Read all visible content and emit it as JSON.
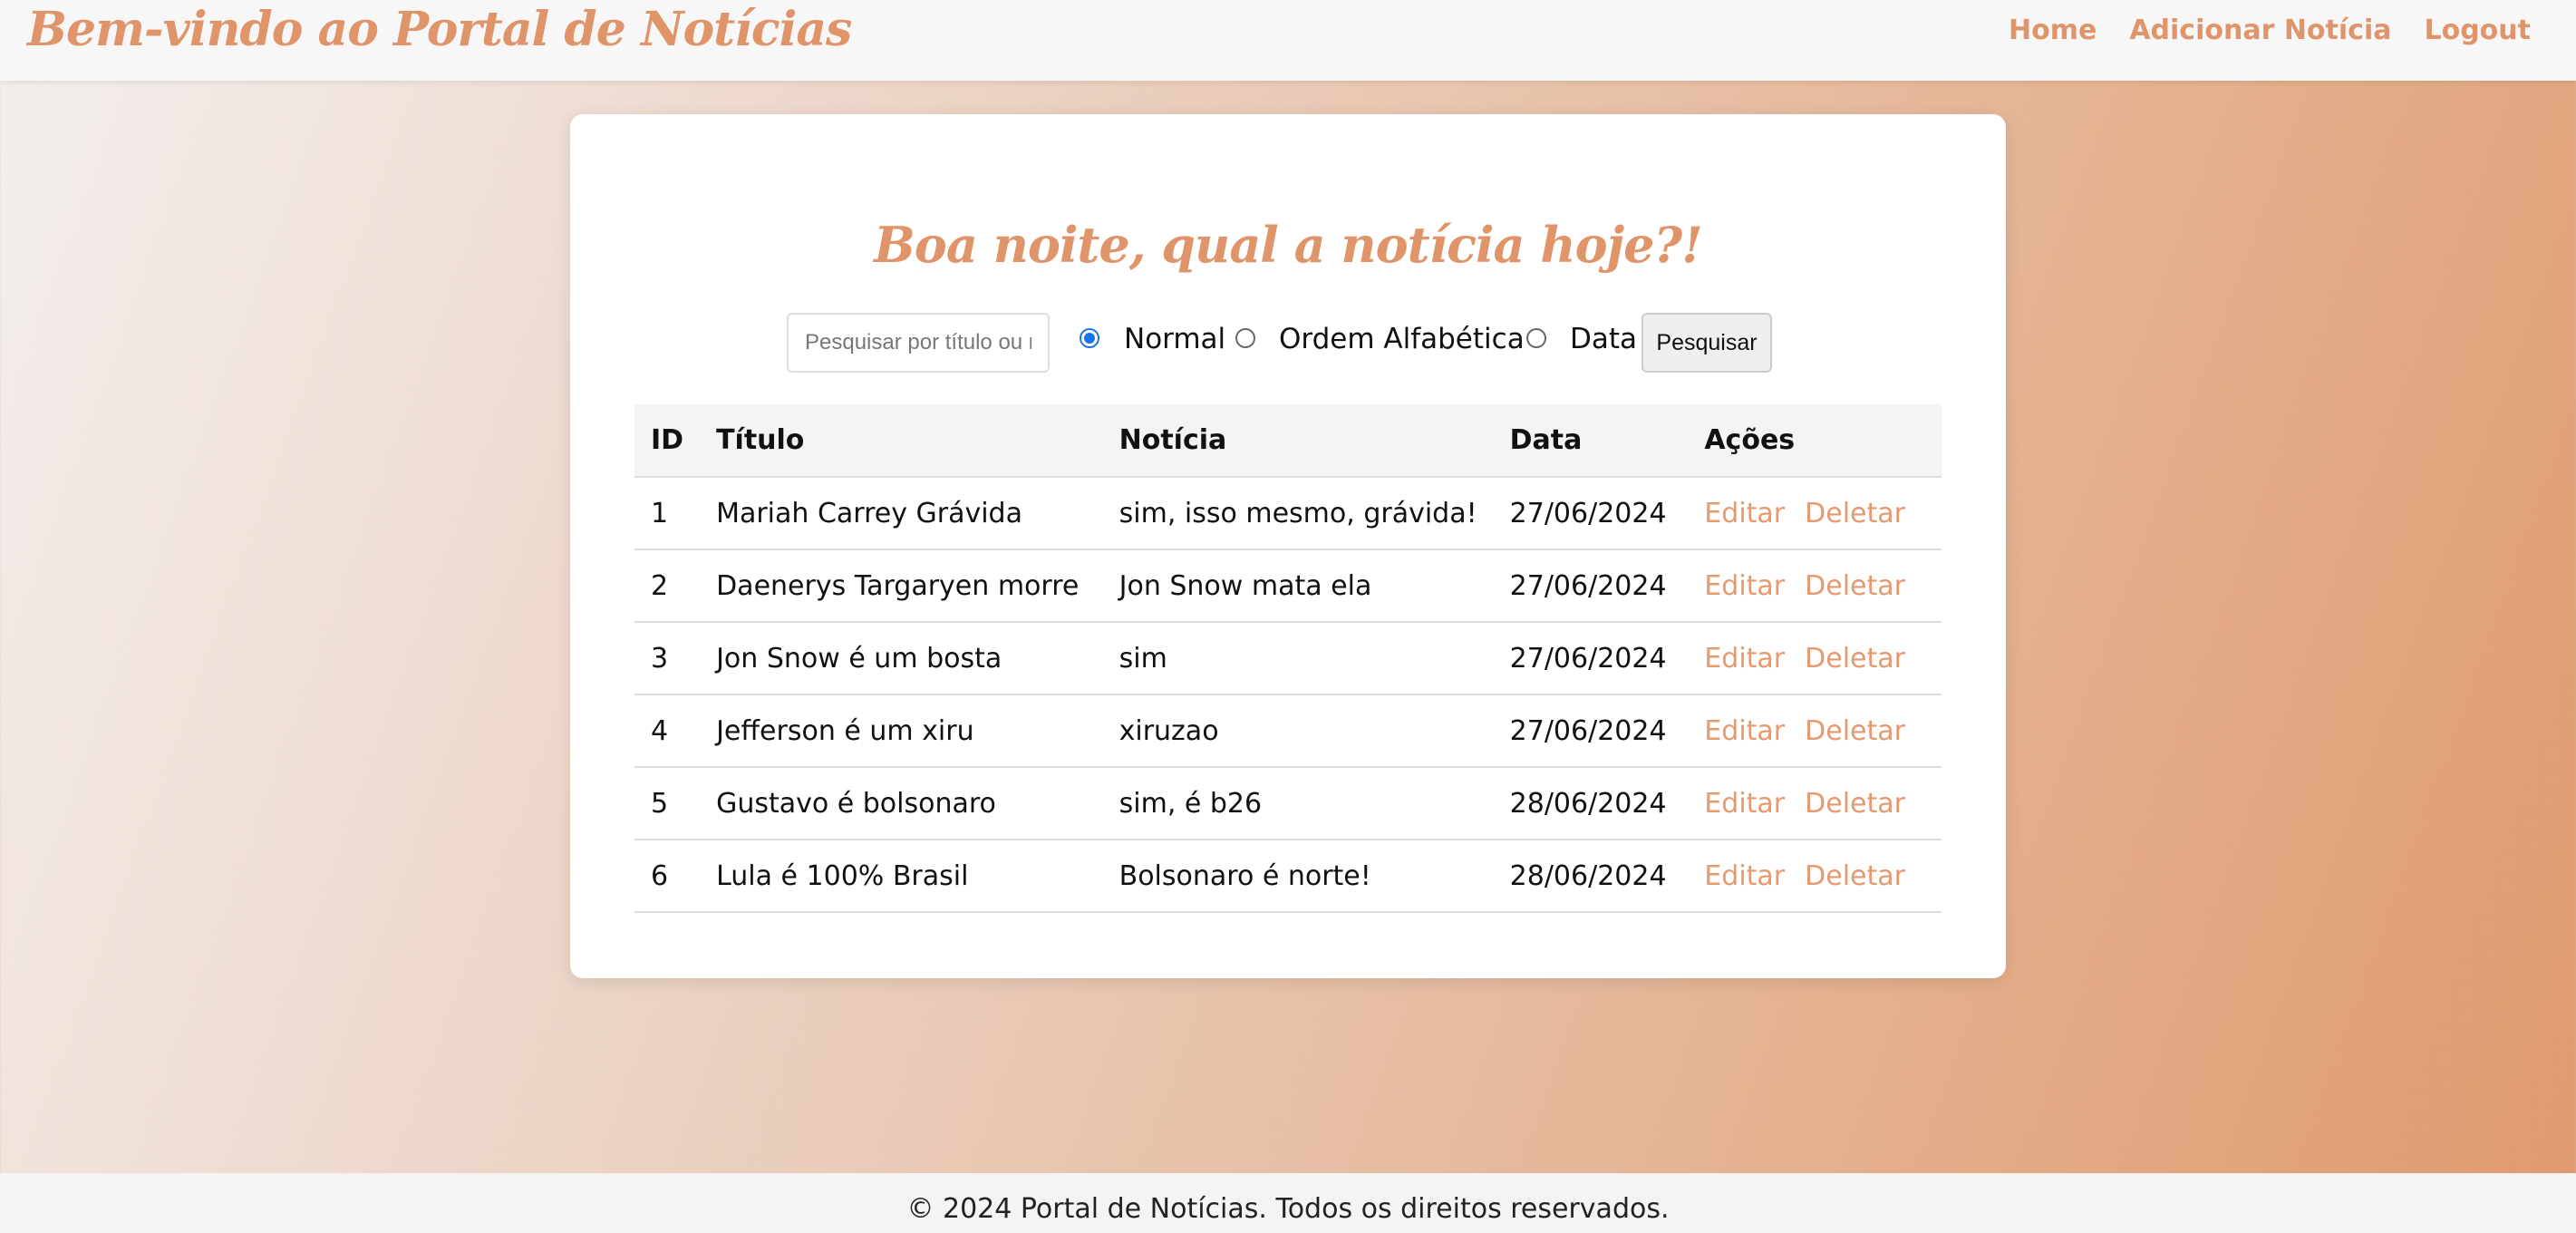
{
  "header": {
    "brand": "Bem-vindo ao Portal de Notícias",
    "nav": [
      "Home",
      "Adicionar Notícia",
      "Logout"
    ]
  },
  "main": {
    "greeting": "Boa noite, qual a notícia hoje?!",
    "search": {
      "placeholder": "Pesquisar por título ou n",
      "value": "",
      "button_label": "Pesquisar"
    },
    "sort_options": [
      {
        "label": "Normal",
        "checked": true
      },
      {
        "label": "Ordem Alfabética",
        "checked": false
      },
      {
        "label": "Data",
        "checked": false
      }
    ],
    "table": {
      "headers": [
        "ID",
        "Título",
        "Notícia",
        "Data",
        "Ações"
      ],
      "action_labels": {
        "edit": "Editar",
        "delete": "Deletar"
      },
      "rows": [
        {
          "id": "1",
          "titulo": "Mariah Carrey Grávida",
          "noticia": "sim, isso mesmo, grávida!",
          "data": "27/06/2024"
        },
        {
          "id": "2",
          "titulo": "Daenerys Targaryen morre",
          "noticia": "Jon Snow mata ela",
          "data": "27/06/2024"
        },
        {
          "id": "3",
          "titulo": "Jon Snow é um bosta",
          "noticia": "sim",
          "data": "27/06/2024"
        },
        {
          "id": "4",
          "titulo": "Jefferson é um xiru",
          "noticia": "xiruzao",
          "data": "27/06/2024"
        },
        {
          "id": "5",
          "titulo": "Gustavo é bolsonaro",
          "noticia": "sim, é b26",
          "data": "28/06/2024"
        },
        {
          "id": "6",
          "titulo": "Lula é 100% Brasil",
          "noticia": "Bolsonaro é norte!",
          "data": "28/06/2024"
        }
      ]
    }
  },
  "footer": {
    "text": "© 2024 Portal de Notícias. Todos os direitos reservados."
  },
  "colors": {
    "accent": "#e0946a",
    "radio_checked": "#1a73e8"
  }
}
